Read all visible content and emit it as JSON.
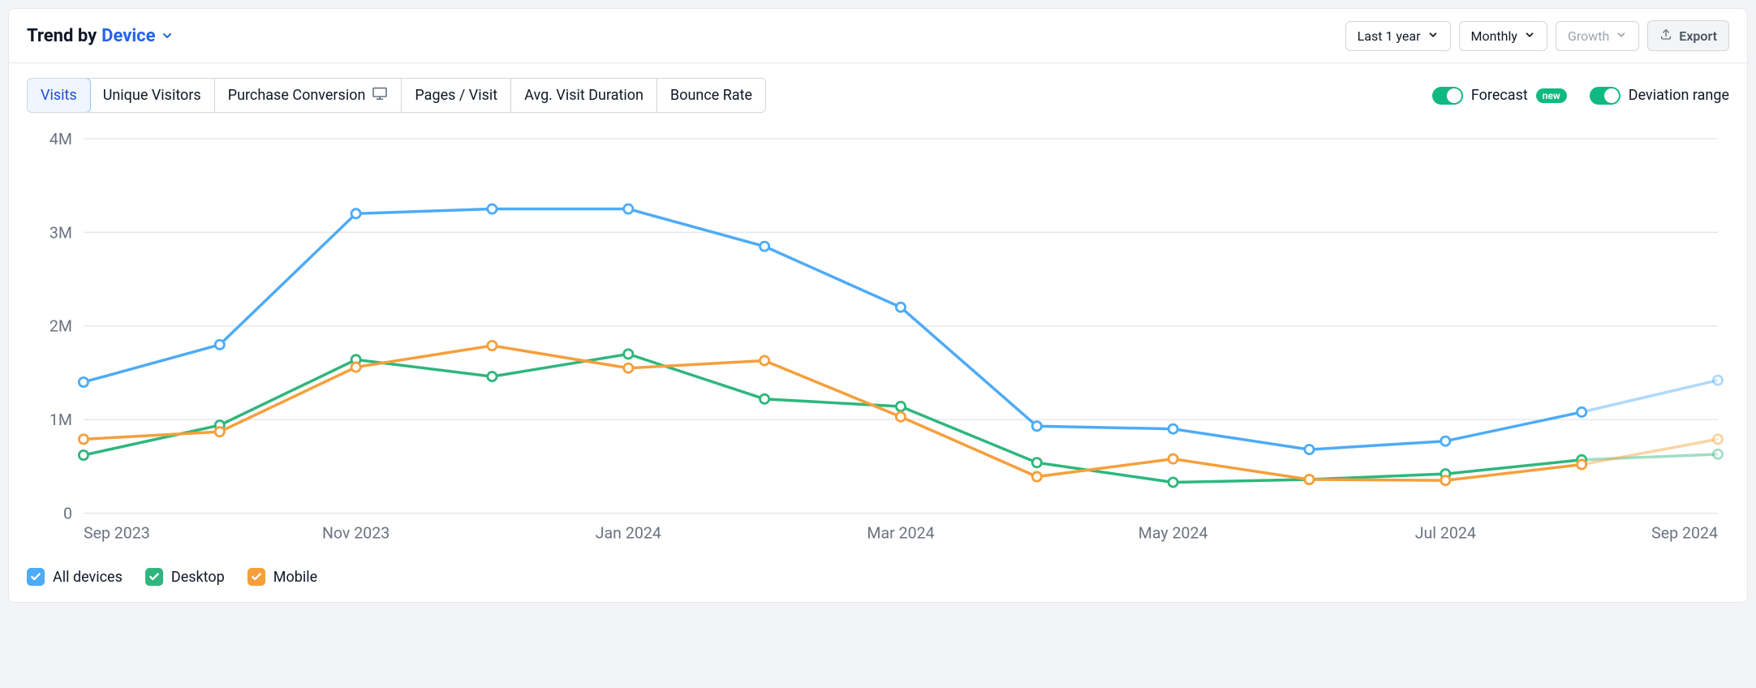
{
  "header": {
    "title_prefix": "Trend by",
    "dimension": "Device",
    "selects": {
      "range": "Last 1 year",
      "granularity": "Monthly",
      "growth": "Growth"
    },
    "export_label": "Export"
  },
  "tabs": [
    {
      "label": "Visits",
      "active": true
    },
    {
      "label": "Unique Visitors",
      "active": false
    },
    {
      "label": "Purchase Conversion",
      "active": false,
      "desktop_only": true
    },
    {
      "label": "Pages / Visit",
      "active": false
    },
    {
      "label": "Avg. Visit Duration",
      "active": false
    },
    {
      "label": "Bounce Rate",
      "active": false
    }
  ],
  "toggles": {
    "forecast": {
      "label": "Forecast",
      "on": true,
      "badge": "new"
    },
    "deviation": {
      "label": "Deviation range",
      "on": true
    }
  },
  "legend": [
    {
      "label": "All devices",
      "color": "#4dabf7"
    },
    {
      "label": "Desktop",
      "color": "#2fb67c"
    },
    {
      "label": "Mobile",
      "color": "#f59f3c"
    }
  ],
  "chart_data": {
    "type": "line",
    "title": "Trend by Device — Visits",
    "xlabel": "",
    "ylabel": "",
    "ylim": [
      0,
      4000000
    ],
    "y_ticks": [
      0,
      1000000,
      2000000,
      3000000,
      4000000
    ],
    "y_tick_labels": [
      "0",
      "1M",
      "2M",
      "3M",
      "4M"
    ],
    "categories": [
      "Sep 2023",
      "Oct 2023",
      "Nov 2023",
      "Dec 2023",
      "Jan 2024",
      "Feb 2024",
      "Mar 2024",
      "Apr 2024",
      "May 2024",
      "Jun 2024",
      "Jul 2024",
      "Aug 2024",
      "Sep 2024"
    ],
    "x_tick_labels": [
      "Sep 2023",
      "",
      "Nov 2023",
      "",
      "Jan 2024",
      "",
      "Mar 2024",
      "",
      "May 2024",
      "",
      "Jul 2024",
      "",
      "Sep 2024"
    ],
    "series": [
      {
        "name": "All devices",
        "color": "#4dabf7",
        "values": [
          1400000,
          1800000,
          3200000,
          3250000,
          3250000,
          2850000,
          2200000,
          930000,
          900000,
          680000,
          770000,
          1080000,
          1420000
        ],
        "forecast_from_index": 11
      },
      {
        "name": "Desktop",
        "color": "#2fb67c",
        "values": [
          620000,
          940000,
          1640000,
          1460000,
          1700000,
          1220000,
          1140000,
          540000,
          330000,
          360000,
          420000,
          570000,
          630000
        ],
        "forecast_from_index": 11
      },
      {
        "name": "Mobile",
        "color": "#f59f3c",
        "values": [
          790000,
          870000,
          1560000,
          1790000,
          1550000,
          1630000,
          1030000,
          390000,
          580000,
          360000,
          350000,
          520000,
          790000
        ],
        "forecast_from_index": 11
      }
    ]
  }
}
